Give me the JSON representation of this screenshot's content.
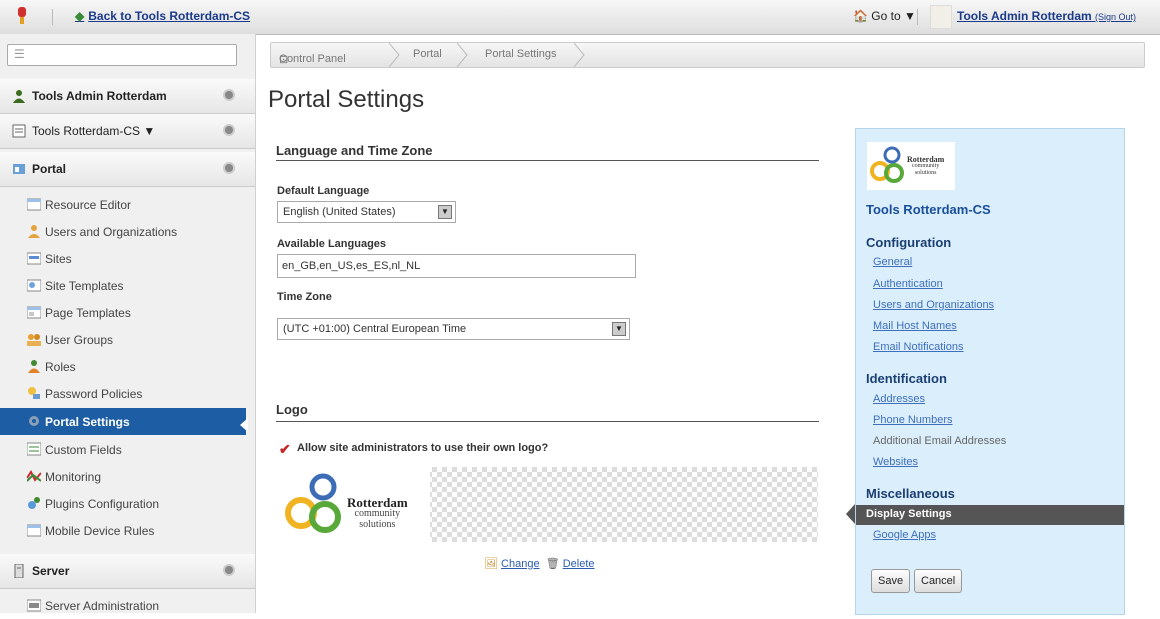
{
  "dock": {
    "back_label": "Back to Tools Rotterdam-CS",
    "goto_label": "Go to ▼",
    "user_name": "Tools Admin Rotterdam",
    "sign_out": "(Sign Out)"
  },
  "left_panel": {
    "search_placeholder": "",
    "user_row": "Tools Admin Rotterdam",
    "site_row": "Tools Rotterdam-CS ▼",
    "portal_header": "Portal",
    "items": [
      {
        "label": "Resource Editor",
        "icon": "resource-editor-icon"
      },
      {
        "label": "Users and Organizations",
        "icon": "users-icon"
      },
      {
        "label": "Sites",
        "icon": "sites-icon"
      },
      {
        "label": "Site Templates",
        "icon": "site-templates-icon"
      },
      {
        "label": "Page Templates",
        "icon": "page-templates-icon"
      },
      {
        "label": "User Groups",
        "icon": "user-groups-icon"
      },
      {
        "label": "Roles",
        "icon": "roles-icon"
      },
      {
        "label": "Password Policies",
        "icon": "password-policies-icon"
      },
      {
        "label": "Portal Settings",
        "icon": "portal-settings-icon",
        "active": true
      },
      {
        "label": "Custom Fields",
        "icon": "custom-fields-icon"
      },
      {
        "label": "Monitoring",
        "icon": "monitoring-icon"
      },
      {
        "label": "Plugins Configuration",
        "icon": "plugins-icon"
      },
      {
        "label": "Mobile Device Rules",
        "icon": "mobile-rules-icon"
      }
    ],
    "server_header": "Server",
    "server_items": [
      {
        "label": "Server Administration"
      }
    ]
  },
  "breadcrumb": [
    "Control Panel",
    "Portal",
    "Portal Settings"
  ],
  "main": {
    "title": "Portal Settings",
    "lang_section": "Language and Time Zone",
    "default_language_label": "Default Language",
    "default_language_value": "English (United States)",
    "available_languages_label": "Available Languages",
    "available_languages_value": "en_GB,en_US,es_ES,nl_NL",
    "time_zone_label": "Time Zone",
    "time_zone_value": "(UTC +01:00) Central European Time",
    "logo_section": "Logo",
    "allow_logo_label": "Allow site administrators to use their own logo?",
    "allow_logo_checked": true,
    "logo_text": [
      "Rotterdam",
      "community",
      "solutions"
    ],
    "change_label": "Change",
    "delete_label": "Delete"
  },
  "right_panel": {
    "logo_text": [
      "Rotterdam",
      "community",
      "solutions"
    ],
    "site_name": "Tools Rotterdam-CS",
    "configuration_header": "Configuration",
    "configuration_links": [
      "General",
      "Authentication",
      "Users and Organizations",
      "Mail Host Names",
      "Email Notifications"
    ],
    "identification_header": "Identification",
    "identification_links": [
      "Addresses",
      "Phone Numbers",
      "Additional Email Addresses",
      "Websites"
    ],
    "miscellaneous_header": "Miscellaneous",
    "misc_items": [
      "Display Settings",
      "Google Apps"
    ],
    "save_label": "Save",
    "cancel_label": "Cancel"
  },
  "colors": {
    "accent": "#1d5da3",
    "right_panel_bg": "#dbeefb",
    "active_right_item": "#555555"
  }
}
